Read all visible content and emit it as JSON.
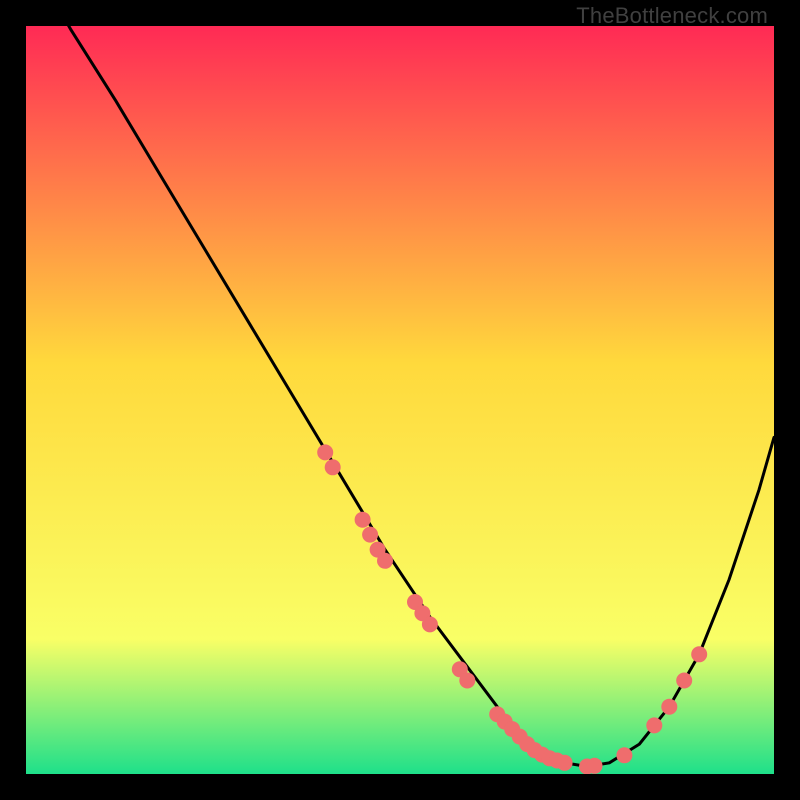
{
  "watermark": "TheBottleneck.com",
  "chart_data": {
    "type": "line",
    "title": "",
    "xlabel": "",
    "ylabel": "",
    "xlim": [
      0,
      100
    ],
    "ylim": [
      0,
      100
    ],
    "grid": false,
    "legend": false,
    "background_gradient": {
      "top": "#ff2a55",
      "upper_mid": "#ffd93c",
      "lower_mid": "#f9ff66",
      "bottom": "#1ee08a"
    },
    "series": [
      {
        "name": "bottleneck-curve",
        "color": "#000000",
        "x": [
          0,
          6,
          12,
          18,
          24,
          30,
          36,
          42,
          48,
          54,
          60,
          63,
          66,
          69,
          72,
          75,
          78,
          82,
          86,
          90,
          94,
          98,
          100
        ],
        "y": [
          110,
          99.5,
          90,
          80,
          70,
          60,
          50,
          40,
          30,
          21,
          13,
          9,
          5.5,
          3,
          1.5,
          1,
          1.5,
          4,
          9,
          16,
          26,
          38,
          45
        ]
      }
    ],
    "markers": {
      "name": "highlighted-points",
      "color": "#ef6d6d",
      "radius": 8,
      "points": [
        {
          "x": 40,
          "y": 43
        },
        {
          "x": 41,
          "y": 41
        },
        {
          "x": 45,
          "y": 34
        },
        {
          "x": 46,
          "y": 32
        },
        {
          "x": 47,
          "y": 30
        },
        {
          "x": 48,
          "y": 28.5
        },
        {
          "x": 52,
          "y": 23
        },
        {
          "x": 53,
          "y": 21.5
        },
        {
          "x": 54,
          "y": 20
        },
        {
          "x": 58,
          "y": 14
        },
        {
          "x": 59,
          "y": 12.5
        },
        {
          "x": 63,
          "y": 8
        },
        {
          "x": 64,
          "y": 7
        },
        {
          "x": 65,
          "y": 6
        },
        {
          "x": 66,
          "y": 5
        },
        {
          "x": 67,
          "y": 4
        },
        {
          "x": 68,
          "y": 3.2
        },
        {
          "x": 69,
          "y": 2.6
        },
        {
          "x": 70,
          "y": 2.1
        },
        {
          "x": 71,
          "y": 1.8
        },
        {
          "x": 72,
          "y": 1.5
        },
        {
          "x": 75,
          "y": 1
        },
        {
          "x": 76,
          "y": 1.1
        },
        {
          "x": 80,
          "y": 2.5
        },
        {
          "x": 84,
          "y": 6.5
        },
        {
          "x": 86,
          "y": 9
        },
        {
          "x": 88,
          "y": 12.5
        },
        {
          "x": 90,
          "y": 16
        }
      ]
    }
  }
}
